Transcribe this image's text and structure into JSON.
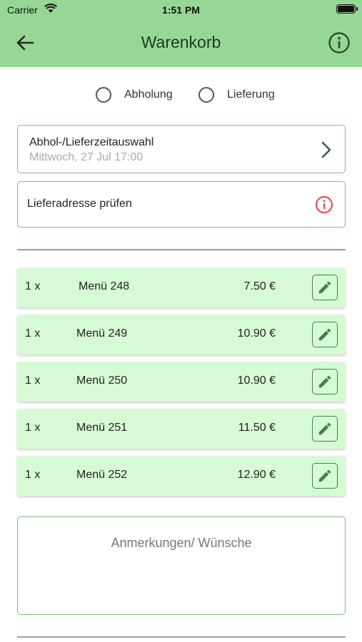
{
  "status_bar": {
    "carrier": "Carrier",
    "time": "1:51 PM"
  },
  "nav": {
    "title": "Warenkorb",
    "back_icon": "arrow-left-icon",
    "info_icon": "info-circle-icon"
  },
  "delivery_options": [
    {
      "label": "Abholung",
      "selected": false
    },
    {
      "label": "Lieferung",
      "selected": false
    }
  ],
  "time_selection": {
    "title": "Abhol-/Lieferzeitauswahl",
    "value": "Mittwoch, 27 Jul 17:00"
  },
  "address_check": {
    "label": "Lieferadresse prüfen",
    "alert_color": "#e05252"
  },
  "cart_items": [
    {
      "qty": "1 x",
      "name": "Menü 248",
      "price": "7.50 €"
    },
    {
      "qty": "1 x",
      "name": "Menü 249",
      "price": "10.90 €"
    },
    {
      "qty": "1 x",
      "name": "Menü 250",
      "price": "10.90 €"
    },
    {
      "qty": "1 x",
      "name": "Menü 251",
      "price": "11.50 €"
    },
    {
      "qty": "1 x",
      "name": "Menü 252",
      "price": "12.90 €"
    }
  ],
  "notes": {
    "placeholder": "Anmerkungen/ Wünsche",
    "value": ""
  },
  "colors": {
    "header": "#97d795",
    "item_bg": "#d6fbd4",
    "border": "#7fbf7a",
    "icon_dark": "#4a7d4a"
  }
}
